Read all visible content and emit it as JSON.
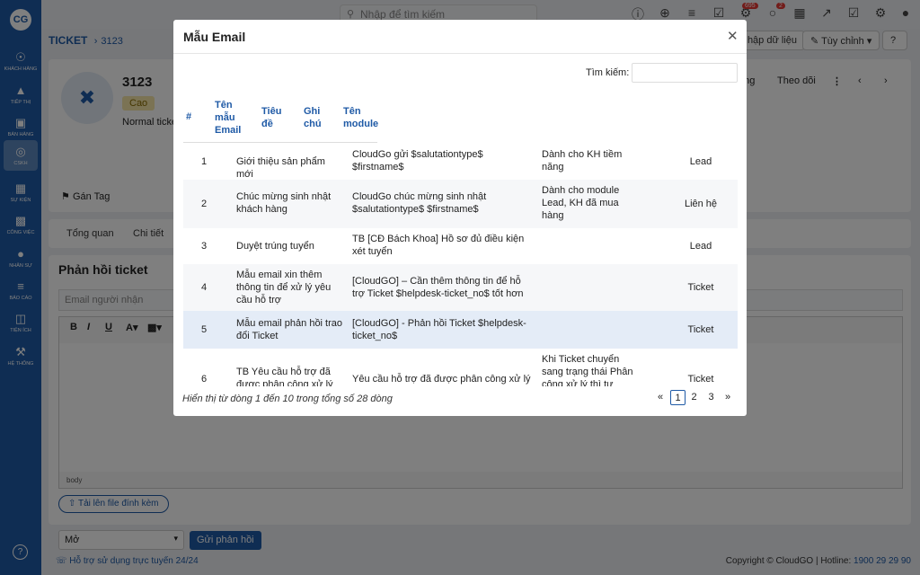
{
  "app": {
    "sidebar": [
      {
        "label": "KHÁCH HÀNG",
        "icon": "users-icon"
      },
      {
        "label": "TIẾP THỊ",
        "icon": "megaphone-icon"
      },
      {
        "label": "BÁN HÀNG",
        "icon": "cart-icon"
      },
      {
        "label": "CSKH",
        "icon": "lifebuoy-icon"
      },
      {
        "label": "SỰ KIỆN",
        "icon": "calendar-icon"
      },
      {
        "label": "CÔNG VIỆC",
        "icon": "briefcase-icon"
      },
      {
        "label": "NHÂN SỰ",
        "icon": "person-icon"
      },
      {
        "label": "BÁO CÁO",
        "icon": "report-icon"
      },
      {
        "label": "TIỆN ÍCH",
        "icon": "utilities-icon"
      },
      {
        "label": "HỆ THỐNG",
        "icon": "wrench-icon"
      }
    ],
    "search_placeholder": "Nhập để tìm kiếm",
    "notif_badges": {
      "bell": "695",
      "chat": "2"
    }
  },
  "breadcrumb": {
    "module": "TICKET",
    "record": "3123"
  },
  "header_buttons": {
    "import": "Nhập dữ liệu",
    "customize": "Tùy chỉnh"
  },
  "ticket": {
    "number": "3123",
    "priority": "Cao",
    "type": "Normal ticke",
    "tag_label": "Gán Tag",
    "right_actions": {
      "a": "ang",
      "follow": "Theo dõi"
    }
  },
  "tabs": [
    "Tổng quan",
    "Chi tiết"
  ],
  "reply": {
    "title": "Phản hồi ticket",
    "email_placeholder": "Email người nhận",
    "editor_path": "body",
    "attach_label": "Tải lên file đính kèm",
    "status_value": "Mở",
    "send_label": "Gửi phản hồi"
  },
  "footer": {
    "support": "Hỗ trợ sử dụng trực tuyến 24/24",
    "copyright": "Copyright © CloudGO | Hotline:",
    "hotline": "1900 29 29 90"
  },
  "modal": {
    "title": "Mẫu Email",
    "search_label": "Tìm kiếm:",
    "columns": {
      "no": "#",
      "name": "Tên mẫu Email",
      "title": "Tiêu đề",
      "note": "Ghi chú",
      "module": "Tên module"
    },
    "rows": [
      {
        "no": "1",
        "name": "Giới thiệu sản phẩm mới",
        "title": "CloudGo gửi $salutationtype$ $firstname$",
        "note": "Dành cho KH tiềm năng",
        "module": "Lead"
      },
      {
        "no": "2",
        "name": "Chúc mừng sinh nhật khách hàng",
        "title": "CloudGo chúc mừng sinh nhật $salutationtype$ $firstname$",
        "note": "Dành cho module Lead, KH đã mua hàng",
        "module": "Liên hệ"
      },
      {
        "no": "3",
        "name": "Duyệt trúng tuyển",
        "title": "TB [CĐ Bách Khoa] Hồ sơ đủ điều kiện xét tuyển",
        "note": "",
        "module": "Lead"
      },
      {
        "no": "4",
        "name": "Mẫu email xin thêm thông tin để xử lý yêu cầu hỗ trợ",
        "title": "[CloudGO] – Cần thêm thông tin để hỗ trợ Ticket $helpdesk-ticket_no$ tốt hơn",
        "note": "",
        "module": "Ticket"
      },
      {
        "no": "5",
        "name": "Mẫu email phản hồi trao đổi Ticket",
        "title": "[CloudGO] - Phản hồi Ticket $helpdesk-ticket_no$",
        "note": "",
        "module": "Ticket"
      },
      {
        "no": "6",
        "name": "TB Yêu cầu hỗ trợ đã được phân công xử lý",
        "title": "Yêu cầu hỗ trợ đã được phân công xử lý",
        "note": "Khi Ticket chuyển sang trạng thái Phân công xử lý thì tự",
        "module": "Ticket"
      }
    ],
    "info": "Hiển thị từ dòng 1 đến 10 trong tổng số 28 dòng",
    "pagination": {
      "prev": "«",
      "pages": [
        "1",
        "2",
        "3"
      ],
      "next": "»",
      "current": "1"
    }
  }
}
